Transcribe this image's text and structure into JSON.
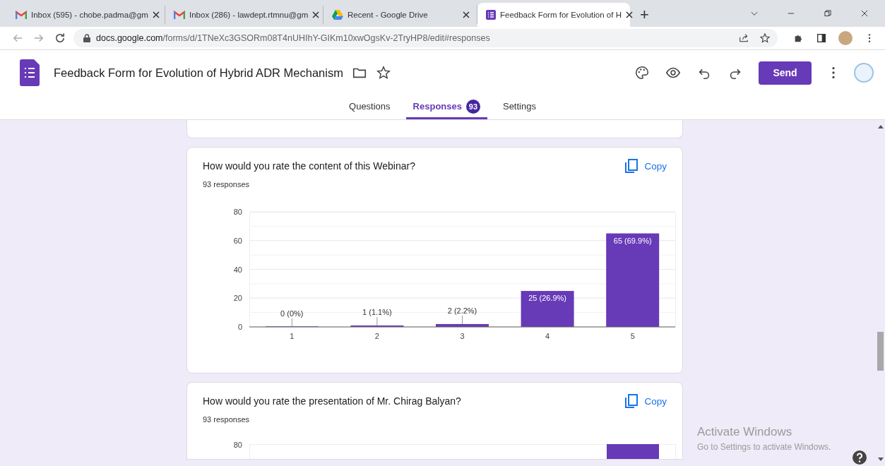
{
  "browser": {
    "tabs": [
      {
        "title": "Inbox (595) - chobe.padma@gm",
        "kind": "mail",
        "selected": false
      },
      {
        "title": "Inbox (286) - lawdept.rtmnu@gm",
        "kind": "mail",
        "selected": false
      },
      {
        "title": "Recent - Google Drive",
        "kind": "drive",
        "selected": false
      },
      {
        "title": "Feedback Form for Evolution of H",
        "kind": "form",
        "selected": true
      }
    ],
    "new_tab": "+",
    "url_host": "docs.google.com",
    "url_path": "/forms/d/1TNeXc3GSORm08T4nUHIhY-GIKm10xwOgsKv-2TryHP8/edit#responses"
  },
  "form": {
    "title": "Feedback Form for Evolution of Hybrid ADR Mechanism",
    "send": "Send",
    "tabs": [
      {
        "label": "Questions",
        "selected": false
      },
      {
        "label": "Responses",
        "selected": true,
        "badge": "93"
      },
      {
        "label": "Settings",
        "selected": false
      }
    ]
  },
  "questions": [
    {
      "title": "How would you rate the content of this Webinar?",
      "responses": "93 responses",
      "copy": "Copy",
      "chart_data": {
        "type": "bar",
        "grid": true,
        "categories": [
          "1",
          "2",
          "3",
          "4",
          "5"
        ],
        "values": [
          0,
          1,
          2,
          25,
          65
        ],
        "ylim": [
          0,
          80
        ],
        "yticks": [
          0,
          20,
          40,
          60,
          80
        ],
        "value_labels": [
          "0 (0%)",
          "1 (1.1%)",
          "2 (2.2%)",
          "25 (26.9%)",
          "65 (69.9%)"
        ]
      }
    },
    {
      "title": "How would you rate the presentation of Mr. Chirag Balyan?",
      "responses": "93 responses",
      "copy": "Copy",
      "axis_top_label": "80"
    }
  ],
  "os_notice": {
    "title": "Activate Windows",
    "text": "Go to Settings to activate Windows."
  }
}
